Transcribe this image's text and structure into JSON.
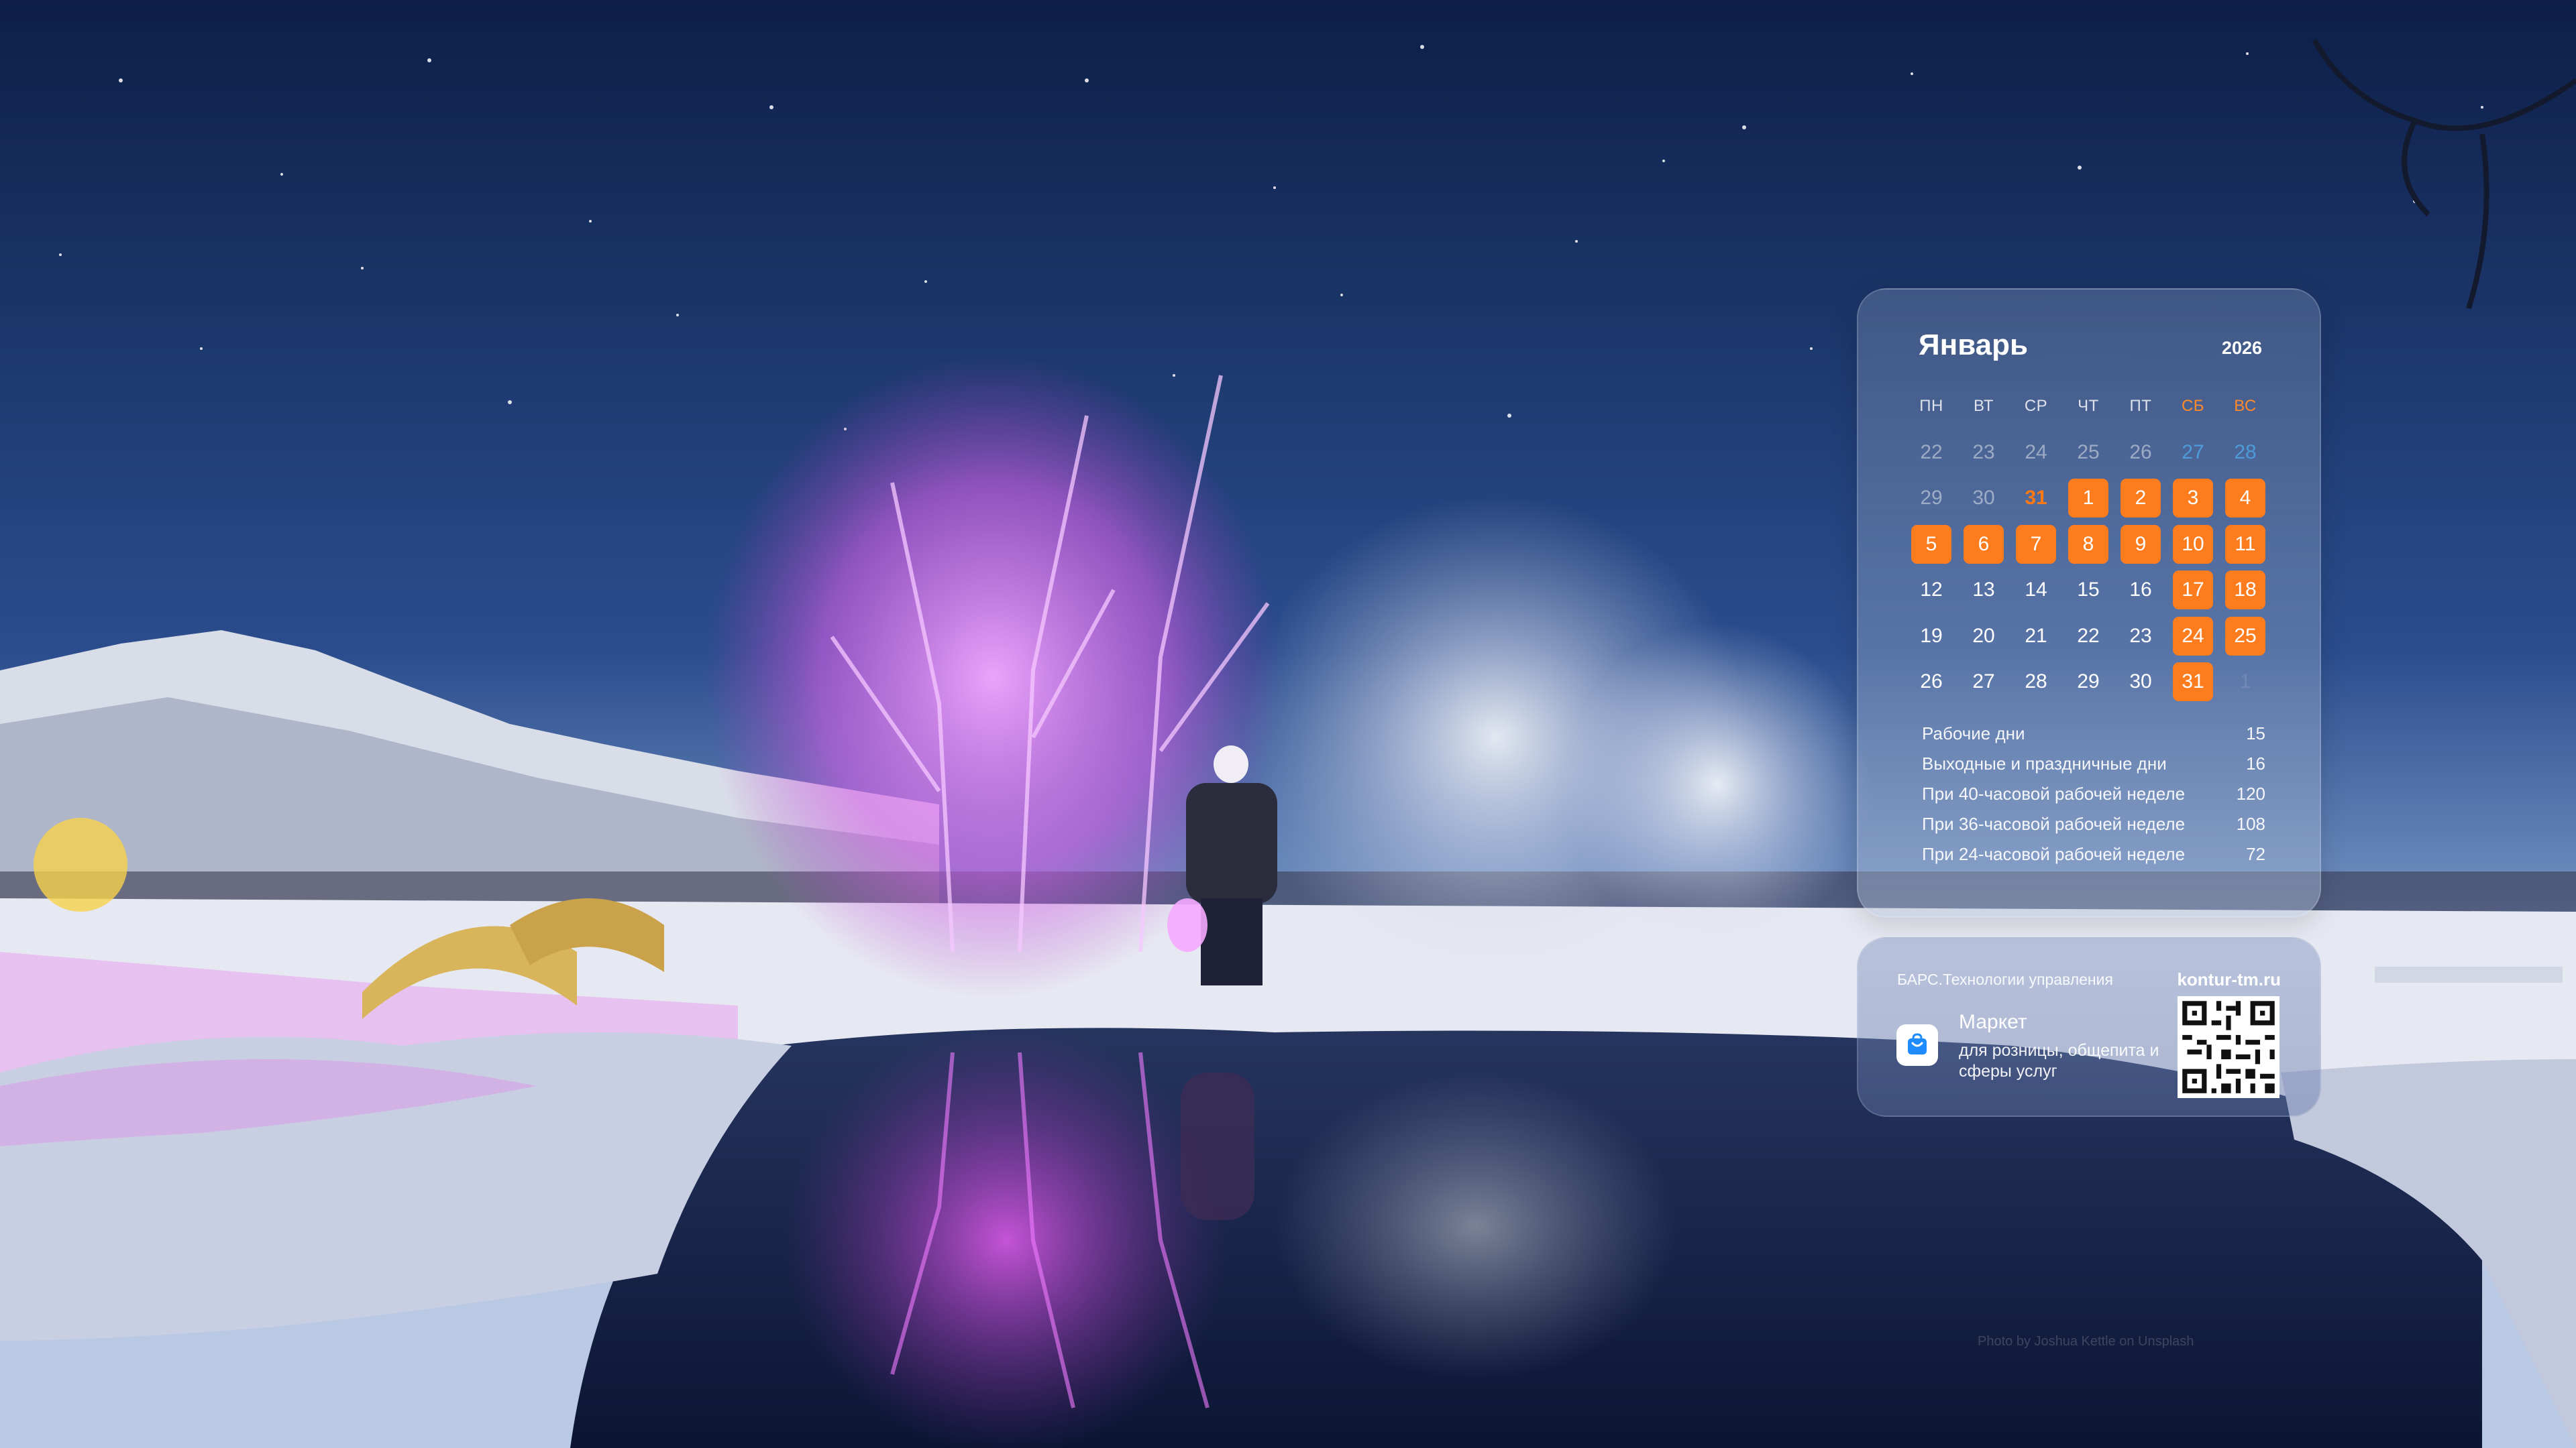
{
  "calendar": {
    "month": "Январь",
    "year": "2026",
    "weekdays": [
      "ПН",
      "ВТ",
      "СР",
      "ЧТ",
      "ПТ",
      "СБ",
      "ВС"
    ],
    "weeks": [
      [
        "22",
        "23",
        "24",
        "25",
        "26",
        "27",
        "28"
      ],
      [
        "29",
        "30",
        "31",
        "1",
        "2",
        "3",
        "4"
      ],
      [
        "5",
        "6",
        "7",
        "8",
        "9",
        "10",
        "11"
      ],
      [
        "12",
        "13",
        "14",
        "15",
        "16",
        "17",
        "18"
      ],
      [
        "19",
        "20",
        "21",
        "22",
        "23",
        "24",
        "25"
      ],
      [
        "26",
        "27",
        "28",
        "29",
        "30",
        "31",
        "1"
      ]
    ],
    "stats": [
      {
        "label": "Рабочие дни",
        "value": "15"
      },
      {
        "label": "Выходные и праздничные дни",
        "value": "16"
      },
      {
        "label": "При 40-часовой рабочей неделе",
        "value": "120"
      },
      {
        "label": "При 36-часовой рабочей неделе",
        "value": "108"
      },
      {
        "label": "При 24-часовой рабочей неделе",
        "value": "72"
      }
    ]
  },
  "ad": {
    "company": "БАРС.Технологии управления",
    "url": "kontur-tm.ru",
    "product": "Маркет",
    "description": "для розницы, общепита и сферы услуг",
    "icon": "shopping-bag-icon"
  },
  "credit": "Photo by Joshua Kettle on Unsplash",
  "colors": {
    "accent": "#fd7c1e",
    "weekend_text": "#ff8a2a",
    "muted_weekend": "#4f9ad9"
  }
}
